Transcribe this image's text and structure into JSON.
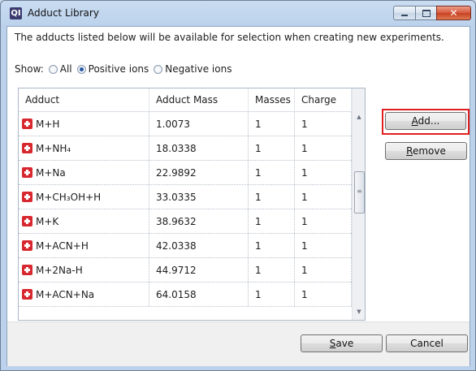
{
  "window": {
    "title": "Adduct Library",
    "app_icon_text": "QI",
    "caption_buttons": {
      "minimize": "",
      "maximize": "",
      "close": "✕"
    }
  },
  "description": "The adducts listed below will be available for selection when creating new experiments.",
  "show": {
    "label": "Show:",
    "options": [
      {
        "label": "All",
        "checked": false
      },
      {
        "label": "Positive ions",
        "checked": true
      },
      {
        "label": "Negative ions",
        "checked": false
      }
    ]
  },
  "table": {
    "columns": [
      "Adduct",
      "Adduct Mass",
      "Masses",
      "Charge"
    ],
    "rows": [
      {
        "adduct": "M+H",
        "mass": "1.0073",
        "masses": "1",
        "charge": "1"
      },
      {
        "adduct": "M+NH₄",
        "mass": "18.0338",
        "masses": "1",
        "charge": "1"
      },
      {
        "adduct": "M+Na",
        "mass": "22.9892",
        "masses": "1",
        "charge": "1"
      },
      {
        "adduct": "M+CH₃OH+H",
        "mass": "33.0335",
        "masses": "1",
        "charge": "1"
      },
      {
        "adduct": "M+K",
        "mass": "38.9632",
        "masses": "1",
        "charge": "1"
      },
      {
        "adduct": "M+ACN+H",
        "mass": "42.0338",
        "masses": "1",
        "charge": "1"
      },
      {
        "adduct": "M+2Na-H",
        "mass": "44.9712",
        "masses": "1",
        "charge": "1"
      },
      {
        "adduct": "M+ACN+Na",
        "mass": "64.0158",
        "masses": "1",
        "charge": "1"
      }
    ],
    "scrollbar": {
      "up": "▲",
      "down": "▼",
      "grip": "≡"
    }
  },
  "buttons": {
    "add_prefix": "",
    "add_underlined": "A",
    "add_rest": "dd...",
    "remove_prefix": "",
    "remove_underlined": "R",
    "remove_rest": "emove",
    "save_underlined": "S",
    "save_rest": "ave",
    "cancel": "Cancel"
  },
  "colors": {
    "highlight_border": "#e02020",
    "plus_icon": "#d8282f",
    "radio_checked": "#2456a5"
  }
}
